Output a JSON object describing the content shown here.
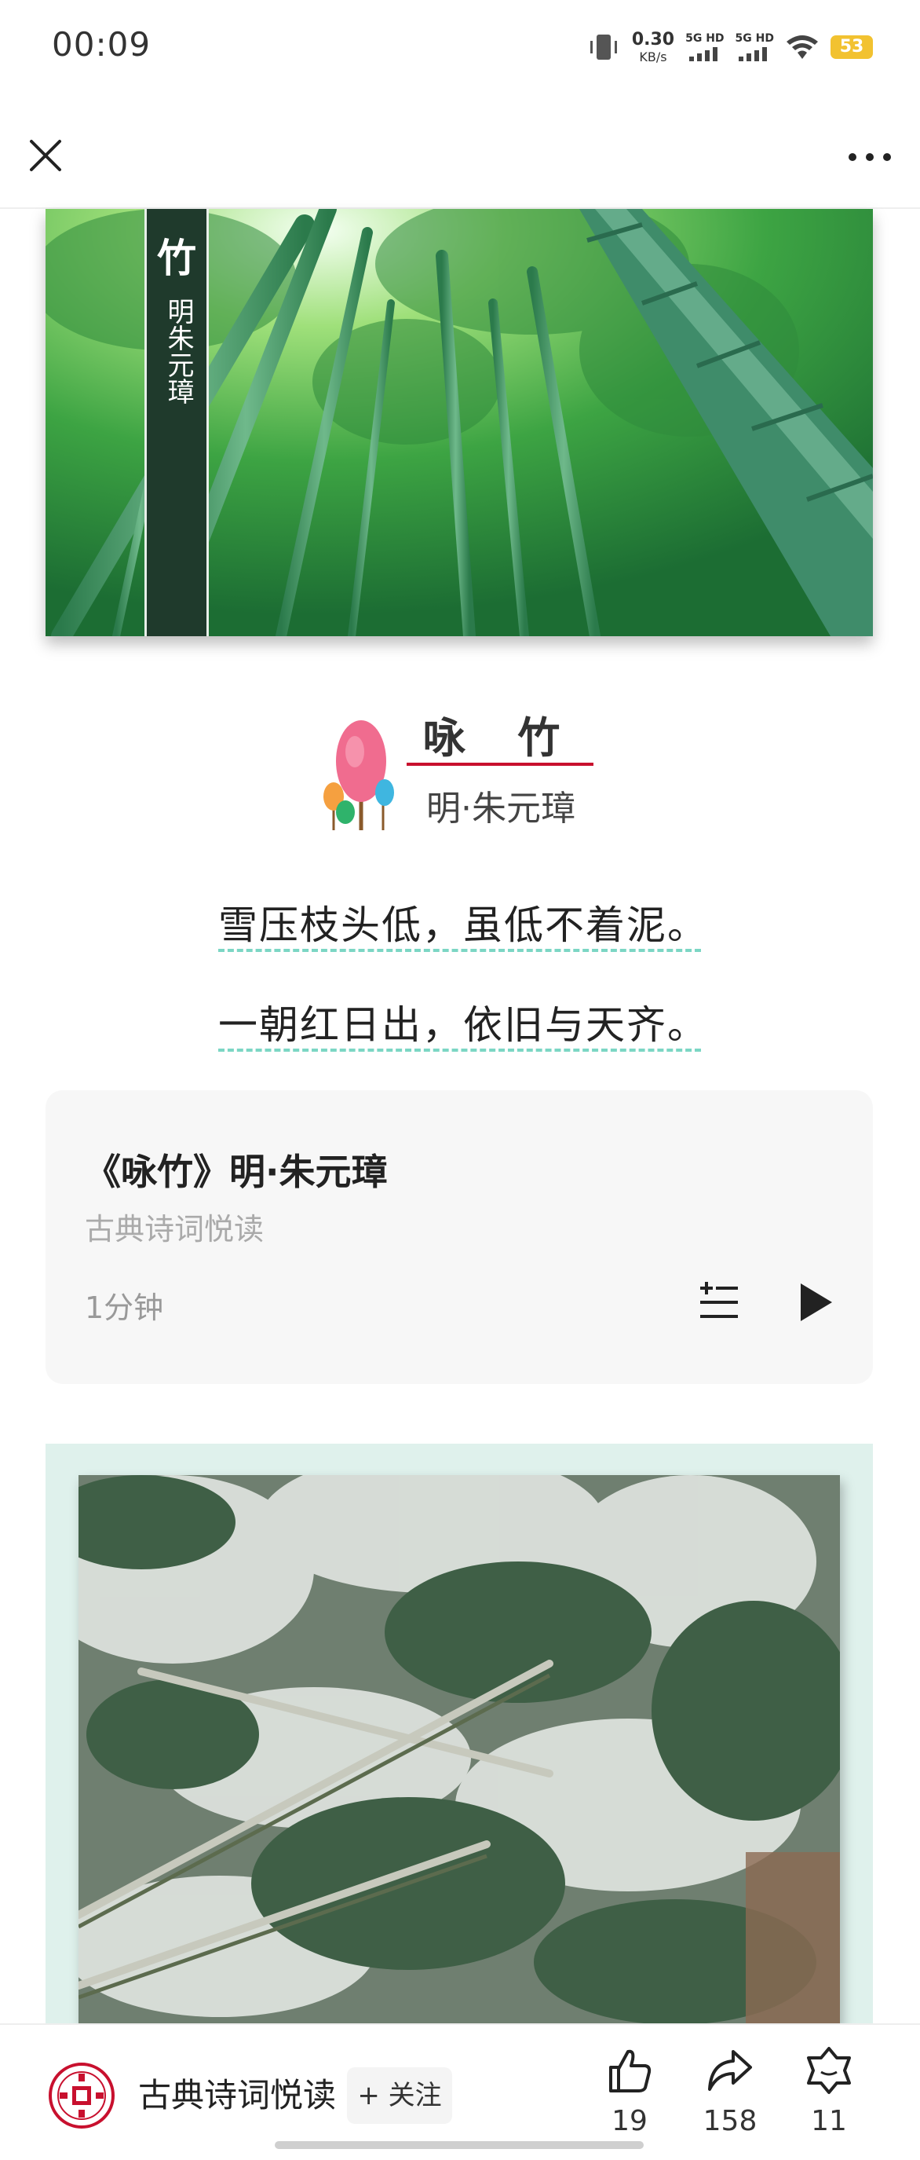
{
  "status_bar": {
    "time": "00:09",
    "net_speed_value": "0.30",
    "net_speed_unit": "KB/s",
    "signal1_label": "5G HD",
    "signal2_label": "5G HD",
    "battery": "53",
    "battery_color": "#F2C230"
  },
  "title_bar": {
    "close_icon": "close-icon",
    "more_icon": "more-icon"
  },
  "hero": {
    "vertical_title": "竹",
    "vertical_author": "明朱元璋"
  },
  "poem": {
    "title": "咏 竹",
    "author": "明·朱元璋",
    "lines": [
      "雪压枝头低，虽低不着泥。",
      "一朝红日出，依旧与天齐。"
    ],
    "accent_color": "#C8102E",
    "underline_color": "#7CD6C4"
  },
  "audio": {
    "title": "《咏竹》明·朱元璋",
    "source": "古典诗词悦读",
    "duration": "1分钟",
    "playlist_icon": "playlist-icon",
    "play_icon": "play-icon"
  },
  "bottom_bar": {
    "account_name": "古典诗词悦读",
    "follow_label": "+ 关注",
    "like_count": "19",
    "share_count": "158",
    "recommend_count": "11",
    "brand_color": "#C8102E"
  }
}
